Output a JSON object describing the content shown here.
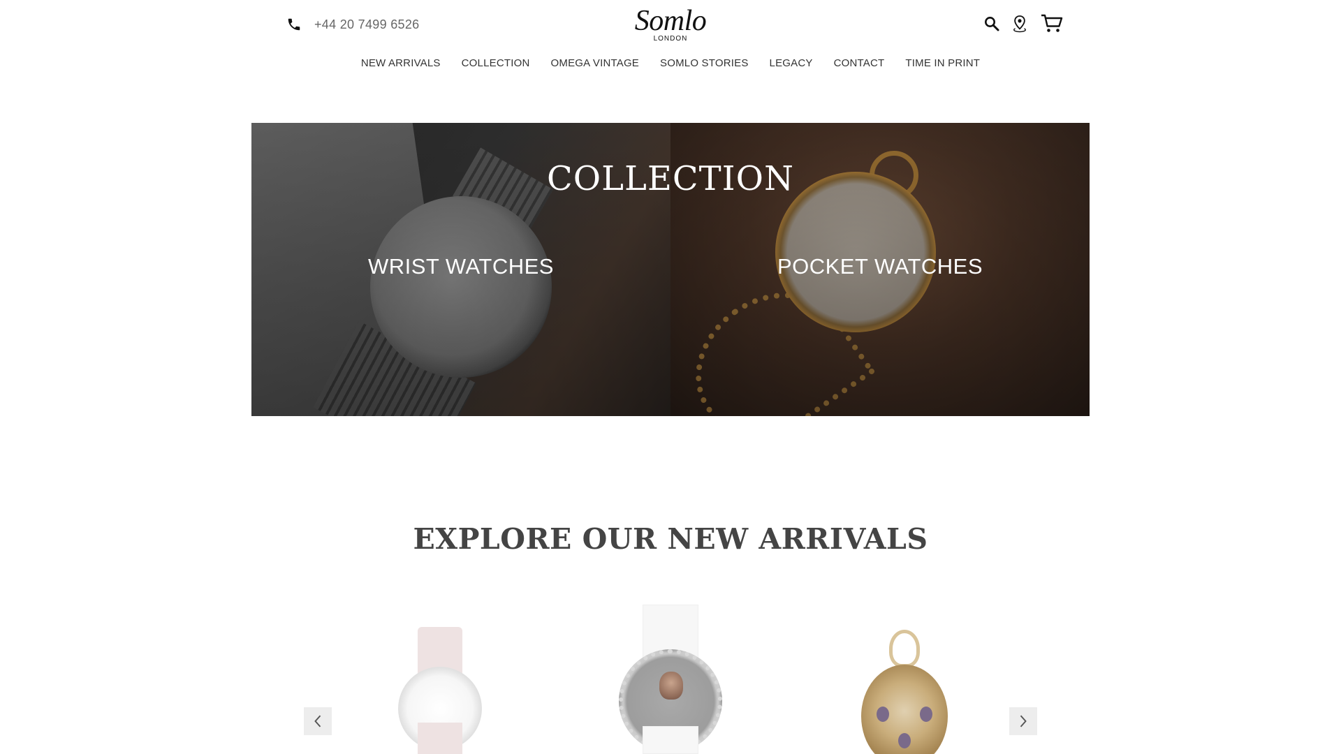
{
  "header": {
    "phone": "+44 20 7499 6526",
    "logo_main": "Somlo",
    "logo_sub": "LONDON"
  },
  "nav": {
    "items": [
      "NEW ARRIVALS",
      "COLLECTION",
      "OMEGA VINTAGE",
      "SOMLO STORIES",
      "LEGACY",
      "CONTACT",
      "TIME IN PRINT"
    ]
  },
  "icons": {
    "phone": "phone-icon",
    "search": "search-icon",
    "location": "location-pin-icon",
    "cart": "cart-icon",
    "prev": "chevron-left-icon",
    "next": "chevron-right-icon"
  },
  "hero": {
    "title": "COLLECTION",
    "left_label": "WRIST WATCHES",
    "right_label": "POCKET WATCHES"
  },
  "arrivals": {
    "title": "EXPLORE OUR NEW ARRIVALS"
  },
  "colors": {
    "text": "#333333",
    "muted": "#666666",
    "carousel_button_bg": "#ededed"
  }
}
